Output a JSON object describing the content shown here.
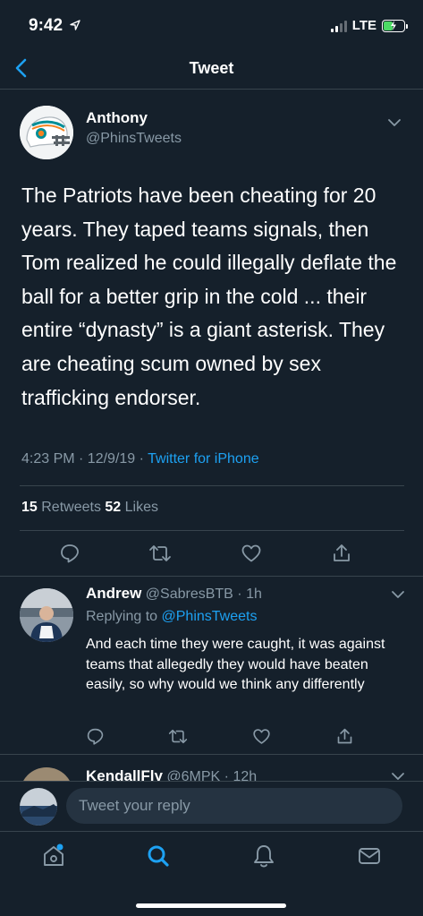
{
  "status_bar": {
    "time": "9:42",
    "network": "LTE"
  },
  "nav": {
    "title": "Tweet"
  },
  "main_tweet": {
    "author_name": "Anthony",
    "author_handle": "@PhinsTweets",
    "text": "The Patriots have been cheating for 20 years. They taped teams signals, then Tom realized he could illegally deflate the ball for a better grip in the cold ... their entire “dynasty” is a giant asterisk. They are cheating scum owned by sex trafficking endorser.",
    "timestamp": "4:23 PM · 12/9/19 · ",
    "source": "Twitter for iPhone",
    "retweet_count": "15",
    "retweet_label": " Retweets ",
    "like_count": "52",
    "like_label": " Likes"
  },
  "reply": {
    "author_name": "Andrew",
    "meta": " @SabresBTB · 1h",
    "replying_to_prefix": "Replying to ",
    "replying_to_handle": "@PhinsTweets",
    "text": "And each time they were caught, it was against teams that allegedly they would have beaten easily, so why would we think any differently"
  },
  "next_reply": {
    "author_name": "KendallFly",
    "meta": " @6MPK · 12h"
  },
  "composer": {
    "placeholder": "Tweet your reply"
  },
  "colors": {
    "background": "#15202b",
    "divider": "#38444d",
    "secondary_text": "#8899a6",
    "accent": "#1da1f2"
  }
}
